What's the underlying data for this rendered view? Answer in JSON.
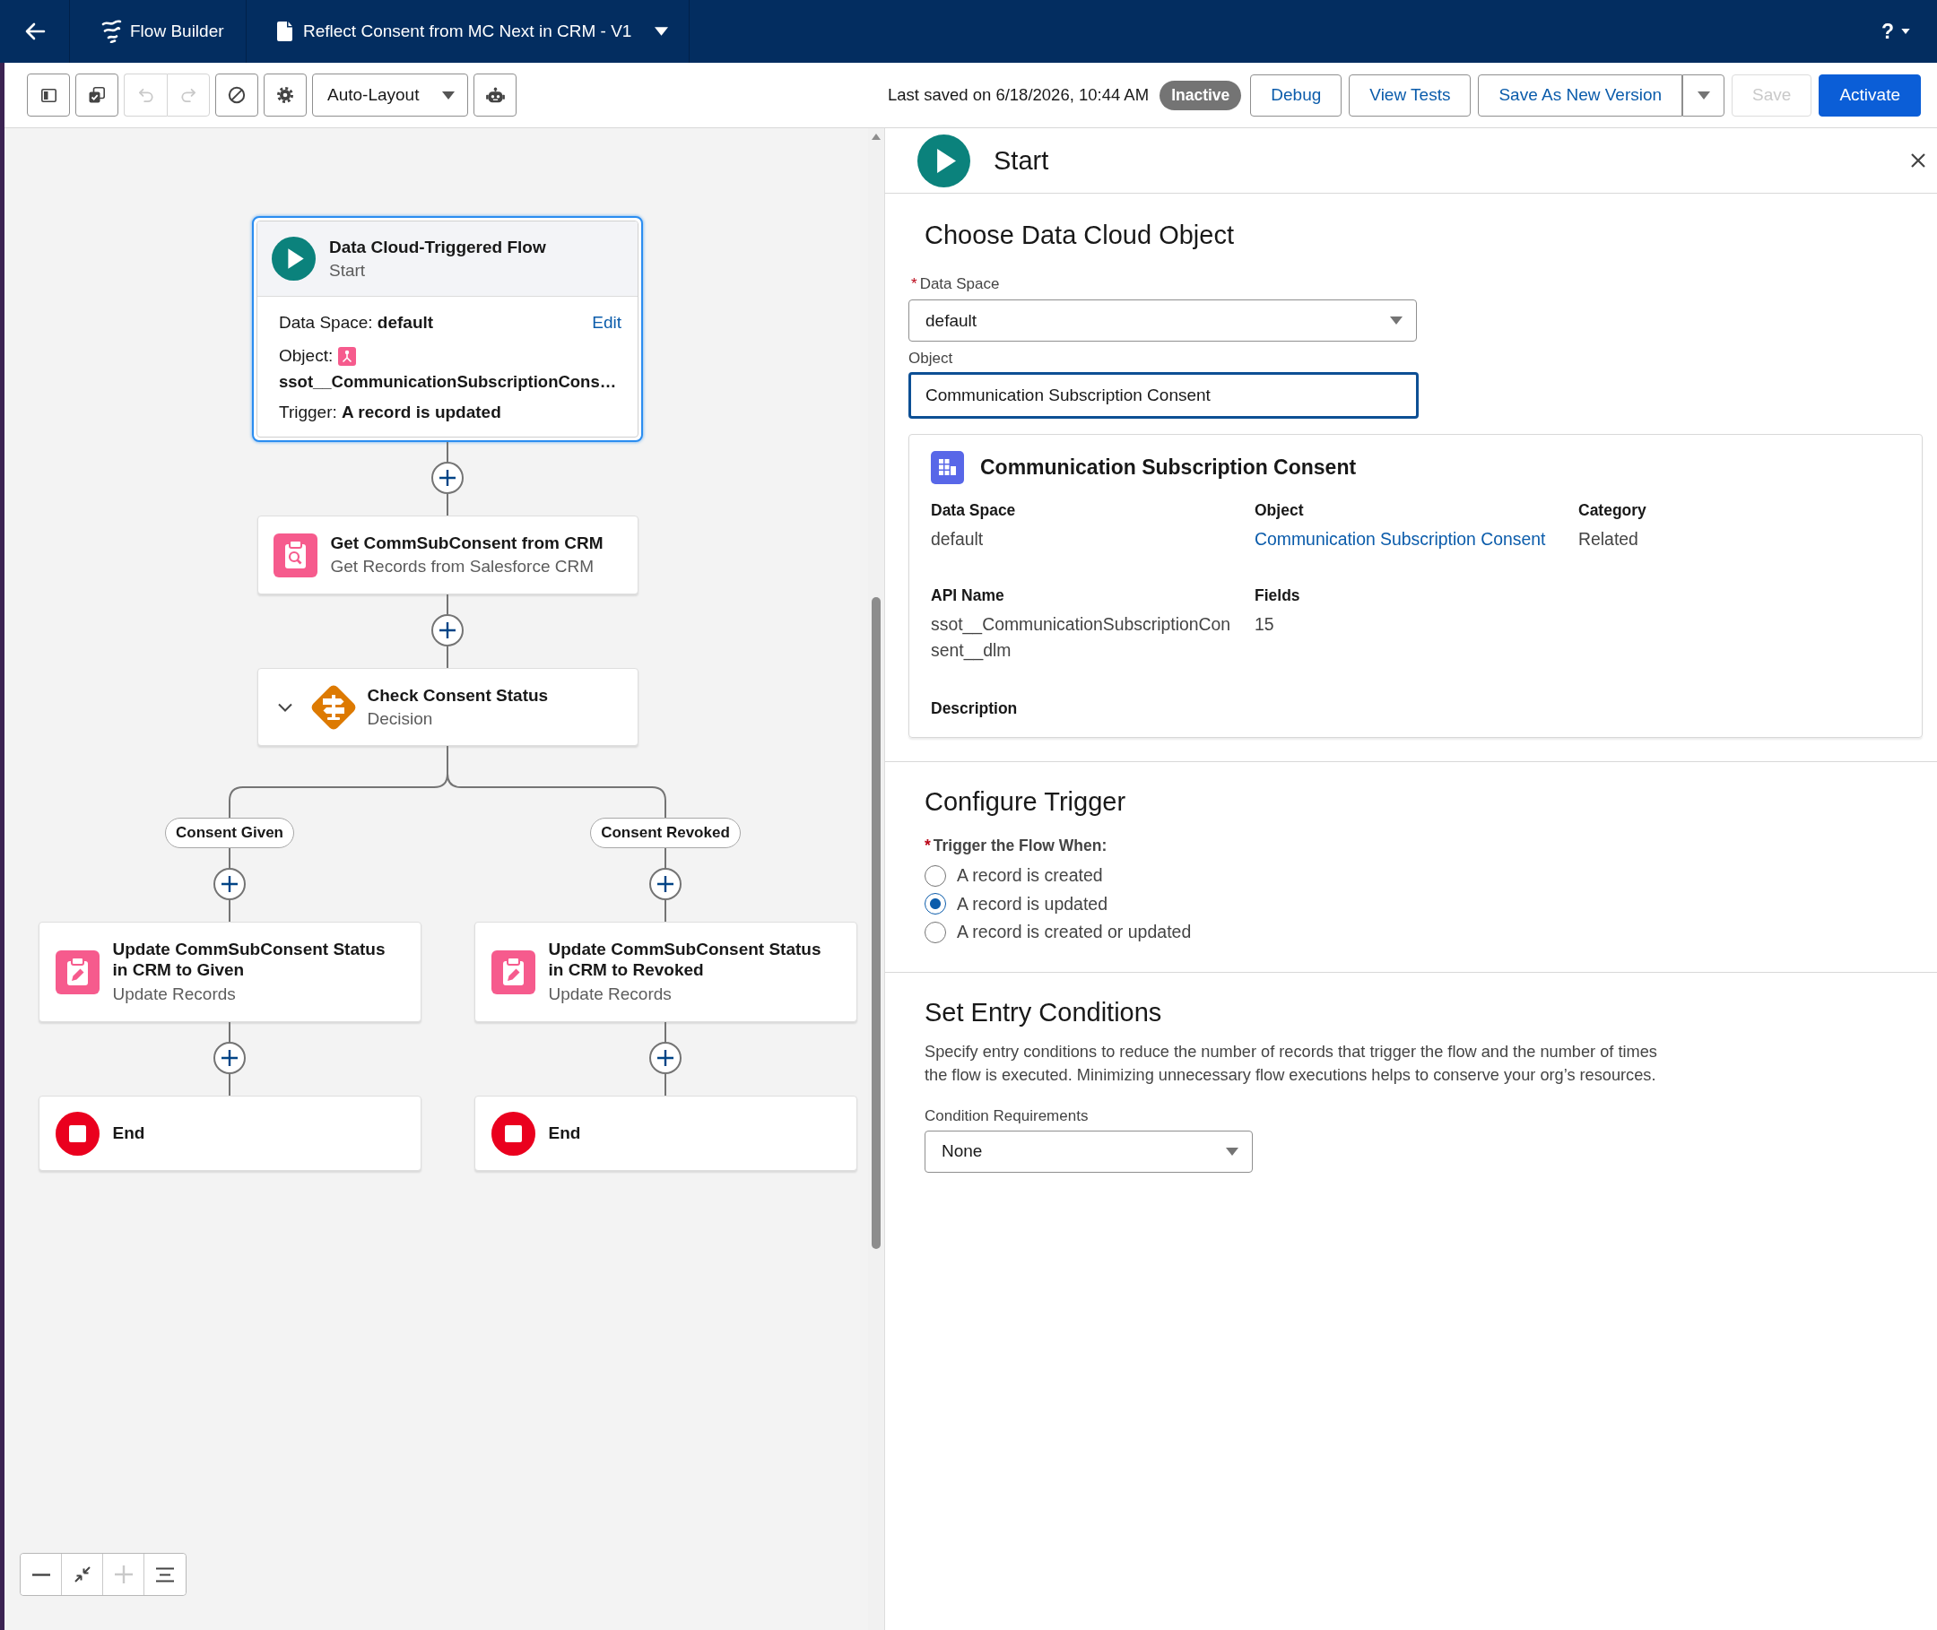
{
  "header": {
    "app_name": "Flow Builder",
    "flow_title": "Reflect Consent from MC Next in CRM - V1",
    "help_label": "?"
  },
  "toolbar": {
    "tool_groups": [
      {
        "tools": [
          {
            "kind": "panel",
            "disabled": false
          }
        ]
      },
      {
        "tools": [
          {
            "kind": "copy",
            "disabled": false
          }
        ]
      },
      {
        "tools": [
          {
            "kind": "undo",
            "disabled": true
          },
          {
            "kind": "redo",
            "disabled": true
          }
        ]
      },
      {
        "tools": [
          {
            "kind": "ban",
            "disabled": false
          }
        ]
      },
      {
        "tools": [
          {
            "kind": "settings",
            "disabled": false
          }
        ]
      },
      {
        "tools": [
          {
            "kind": "layout",
            "label": "Auto-Layout",
            "disabled": false
          }
        ]
      },
      {
        "tools": [
          {
            "kind": "robot",
            "disabled": false
          }
        ]
      }
    ],
    "last_saved": "Last saved on 6/18/2026, 10:44 AM",
    "status": "Inactive",
    "actions": [
      {
        "label": "Debug",
        "kind": "neutral",
        "disabled": false
      },
      {
        "label": "View Tests",
        "kind": "neutral",
        "disabled": false
      },
      {
        "label": "Save As New Version",
        "kind": "split",
        "disabled": false
      },
      {
        "label": "Save",
        "kind": "neutral",
        "disabled": true
      },
      {
        "label": "Activate",
        "kind": "brand",
        "disabled": false
      }
    ]
  },
  "canvas": {
    "start": {
      "title": "Data Cloud-Triggered Flow",
      "subtitle": "Start",
      "selected": true,
      "data_space_label": "Data Space:",
      "data_space": "default",
      "edit": "Edit",
      "object_label": "Object:",
      "object": "ssot__CommunicationSubscriptionCons…",
      "trigger_label": "Trigger:",
      "trigger": "A record is updated"
    },
    "steps": [
      {
        "kind": "get_records",
        "title": "Get CommSubConsent from CRM",
        "subtitle": "Get Records from Salesforce CRM"
      },
      {
        "kind": "decision",
        "title": "Check Consent Status",
        "subtitle": "Decision",
        "expanded": true
      }
    ],
    "branches": [
      {
        "label": "Consent Given",
        "steps": [
          {
            "kind": "update_records",
            "title": "Update CommSubConsent Status in CRM to Given",
            "subtitle": "Update Records"
          },
          {
            "kind": "end",
            "title": "End"
          }
        ]
      },
      {
        "label": "Consent Revoked",
        "steps": [
          {
            "kind": "update_records",
            "title": "Update CommSubConsent Status in CRM to Revoked",
            "subtitle": "Update Records"
          },
          {
            "kind": "end",
            "title": "End"
          }
        ]
      }
    ],
    "zoom_controls": [
      {
        "kind": "zoom_out",
        "disabled": false
      },
      {
        "kind": "fit",
        "disabled": false
      },
      {
        "kind": "zoom_in",
        "disabled": true
      },
      {
        "kind": "arrange",
        "disabled": false
      }
    ]
  },
  "panel": {
    "title": "Start",
    "object_section": {
      "title": "Choose Data Cloud Object",
      "data_space": {
        "required_mark": "*",
        "label": "Data Space",
        "value": "default"
      },
      "object": {
        "label": "Object",
        "value": "Communication Subscription Consent",
        "focused": true
      },
      "card": {
        "title": "Communication Subscription Consent",
        "rows": [
          {
            "fields": [
              {
                "label": "Data Space",
                "value": "default",
                "kind": "text"
              },
              {
                "label": "Object",
                "value": "Communication Subscription Consent",
                "kind": "link"
              },
              {
                "label": "Category",
                "value": "Related",
                "kind": "text"
              }
            ]
          },
          {
            "fields": [
              {
                "label": "API Name",
                "value": "ssot__CommunicationSubscriptionConsent__dlm",
                "kind": "text"
              },
              {
                "label": "Fields",
                "value": "15",
                "kind": "text"
              }
            ]
          },
          {
            "fields": [
              {
                "label": "Description"
              }
            ]
          }
        ]
      }
    },
    "trigger_section": {
      "title": "Configure Trigger",
      "required_mark": "*",
      "label": "Trigger the Flow When:",
      "options": [
        {
          "label": "A record is created",
          "selected": false
        },
        {
          "label": "A record is updated",
          "selected": true
        },
        {
          "label": "A record is created or updated",
          "selected": false
        }
      ]
    },
    "conditions_section": {
      "title": "Set Entry Conditions",
      "description": "Specify entry conditions to reduce the number of records that trigger the flow and the number of times the flow is executed. Minimizing unnecessary flow executions helps to conserve your org’s resources.",
      "requirement": {
        "label": "Condition Requirements",
        "value": "None"
      }
    }
  }
}
